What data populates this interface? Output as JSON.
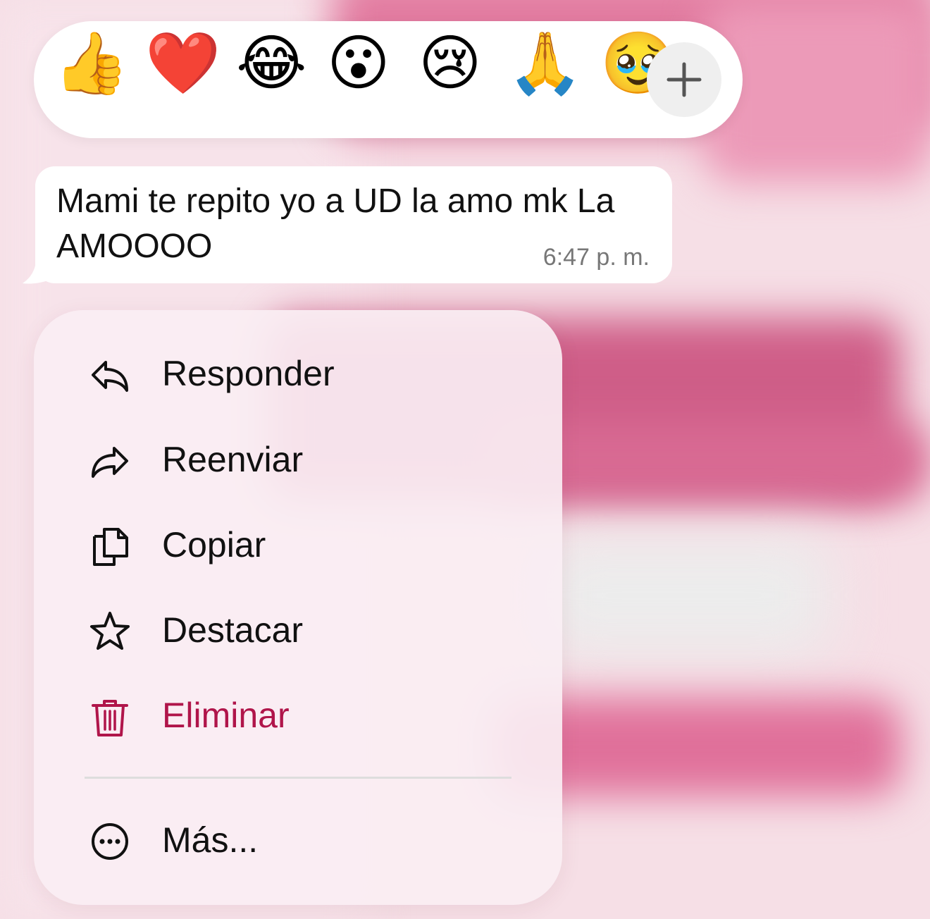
{
  "reactions": {
    "items": [
      {
        "name": "thumbs-up",
        "emoji": "👍"
      },
      {
        "name": "red-heart",
        "emoji": "❤️"
      },
      {
        "name": "tears-of-joy",
        "emoji": "😂"
      },
      {
        "name": "surprised",
        "emoji": "😮"
      },
      {
        "name": "crying",
        "emoji": "😢"
      },
      {
        "name": "folded-hands",
        "emoji": "🙏"
      },
      {
        "name": "holding-back-tears",
        "emoji": "🥹"
      }
    ],
    "more_icon": "plus-icon"
  },
  "message": {
    "text": "Mami te repito yo a UD la amo mk La AMOOOO",
    "time": "6:47 p. m."
  },
  "menu": {
    "items": [
      {
        "label": "Responder",
        "icon": "reply-icon"
      },
      {
        "label": "Reenviar",
        "icon": "forward-icon"
      },
      {
        "label": "Copiar",
        "icon": "copy-icon"
      },
      {
        "label": "Destacar",
        "icon": "star-icon"
      },
      {
        "label": "Eliminar",
        "icon": "trash-icon",
        "color": "#b0154a"
      }
    ],
    "more": {
      "label": "Más...",
      "icon": "more-icon"
    }
  }
}
